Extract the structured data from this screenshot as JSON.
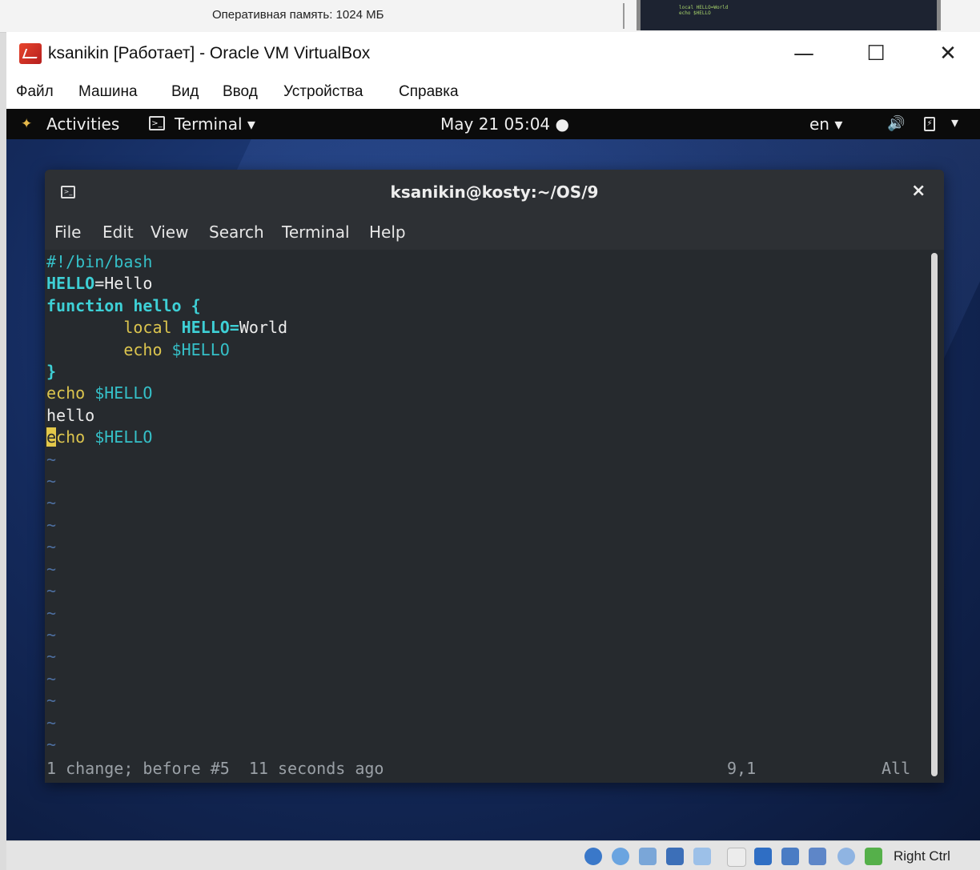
{
  "host": {
    "ram_text": "Оперативная память:  1024 МБ",
    "thumb_lines": [
      "local HELLO=World",
      "echo $HELLO"
    ]
  },
  "vbox": {
    "title": "ksanikin [Работает] - Oracle VM VirtualBox",
    "menu": [
      "Файл",
      "Машина",
      "Вид",
      "Ввод",
      "Устройства",
      "Справка"
    ],
    "window_buttons": {
      "minimize": "—",
      "maximize": "☐",
      "close": "✕"
    },
    "host_key": "Right Ctrl"
  },
  "gnome": {
    "activities": "Activities",
    "app_menu": "Terminal ▾",
    "clock": "May 21  05:04 ●",
    "lang": "en ▾",
    "volume_icon": "🔊",
    "power_icon": "power-icon",
    "chevron": "▾"
  },
  "terminal": {
    "title": "ksanikin@kosty:~/OS/9",
    "close": "×",
    "menu": [
      "File",
      "Edit",
      "View",
      "Search",
      "Terminal",
      "Help"
    ],
    "code": {
      "l1": "#!/bin/bash",
      "l2_var": "HELLO",
      "l2_rest": "=Hello",
      "l3_kw": "function hello {",
      "l4_indent": "        ",
      "l4_local": "local ",
      "l4_var": "HELLO=",
      "l4_val": "World",
      "l5_indent": "        ",
      "l5_echo": "echo ",
      "l5_var": "$HELLO",
      "l6": "}",
      "l7_echo": "echo ",
      "l7_var": "$HELLO",
      "l8": "hello",
      "l9_cursor": "e",
      "l9_echo": "cho ",
      "l9_var": "$HELLO",
      "tilde": "~"
    },
    "status_msg": "1 change; before #5  11 seconds ago",
    "status_pos": "9,1",
    "status_scroll": "All"
  }
}
